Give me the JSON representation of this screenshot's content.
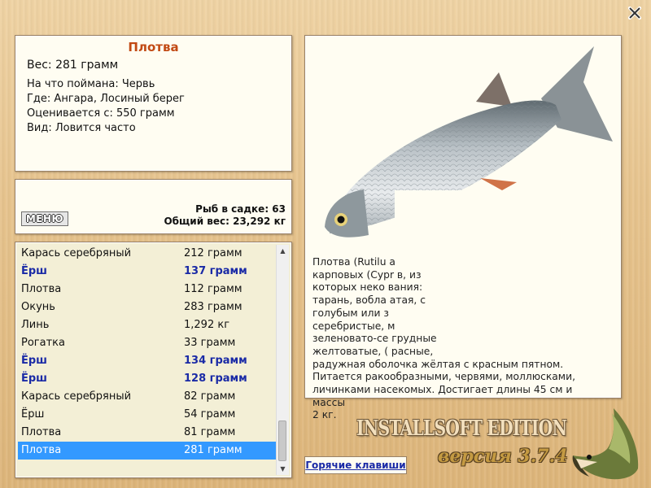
{
  "info": {
    "fish_name": "Плотва",
    "weight": "Вес: 281 грамм",
    "details": [
      "На что поймана: Червь",
      "Где: Ангара, Лосиный берег",
      "Оценивается с: 550 грамм",
      "Вид: Ловится часто"
    ]
  },
  "catch": {
    "menu_label": "МЕНЮ",
    "fish_count": "Рыб в садке: 63",
    "total_weight": "Общий вес: 23,292 кг"
  },
  "list": [
    {
      "name": "Карась серебряный",
      "weight": "212 грамм",
      "bold": false
    },
    {
      "name": "Ёрш",
      "weight": "137 грамм",
      "bold": true
    },
    {
      "name": "Плотва",
      "weight": "112 грамм",
      "bold": false
    },
    {
      "name": "Окунь",
      "weight": "283 грамм",
      "bold": false
    },
    {
      "name": "Линь",
      "weight": "1,292 кг",
      "bold": false
    },
    {
      "name": "Рогатка",
      "weight": "33 грамм",
      "bold": false
    },
    {
      "name": "Ёрш",
      "weight": "134 грамм",
      "bold": true
    },
    {
      "name": "Ёрш",
      "weight": "128 грамм",
      "bold": true
    },
    {
      "name": "Карась серебряный",
      "weight": "82 грамм",
      "bold": false
    },
    {
      "name": "Ёрш",
      "weight": "54 грамм",
      "bold": false
    },
    {
      "name": "Плотва",
      "weight": "81 грамм",
      "bold": false
    },
    {
      "name": "Плотва",
      "weight": "281 грамм",
      "bold": false,
      "selected": true
    }
  ],
  "description": [
    "Плотва (Rutilu                                      а",
    "карповых (Cypr                                    в, из",
    "которых неко                                   вания:",
    "тарань, вобла                                   атая, с",
    "голубым или з",
    "серебристые,                                              м",
    "зеленовато-се                                      грудные",
    "желтоватые, (                                      расные,",
    "радужная оболочка жёлтая с красным пятном.",
    "Питается ракообразными, червями, моллюсками,",
    "личинками насекомых. Достигает длины 45 см и массы",
    "2 кг."
  ],
  "hotkeys_label": "Горячие клавиши",
  "brand": {
    "edition": "INSTALLSOFT EDITION",
    "version": "версия 3.7.4"
  },
  "colors": {
    "title": "#c24a14",
    "link_blue": "#1a2aa6",
    "selection": "#3399ff"
  }
}
